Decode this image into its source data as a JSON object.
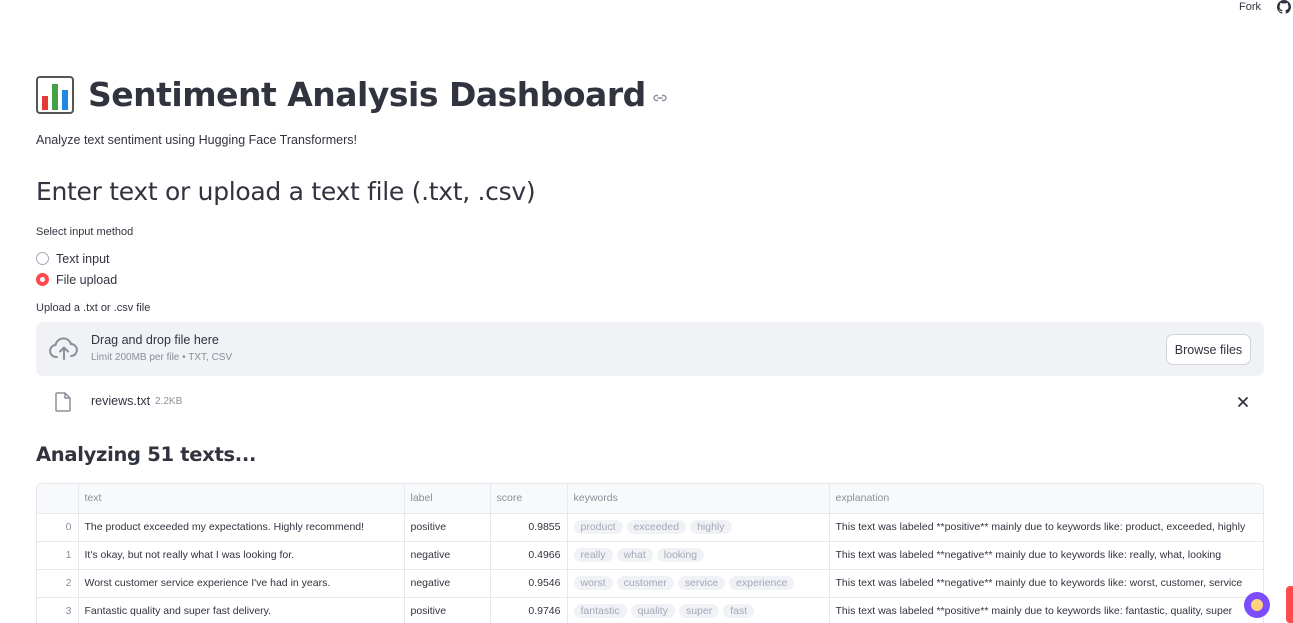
{
  "topbar": {
    "fork_label": "Fork",
    "icon": "github-icon"
  },
  "header": {
    "emoji_icon": "bar-chart-icon",
    "title": "Sentiment Analysis Dashboard",
    "anchor_icon": "link-icon",
    "subtitle": "Analyze text sentiment using Hugging Face Transformers!"
  },
  "input_section": {
    "heading": "Enter text or upload a text file (.txt, .csv)",
    "radio_label": "Select input method",
    "options": [
      {
        "label": "Text input",
        "checked": false
      },
      {
        "label": "File upload",
        "checked": true
      }
    ],
    "accent": "#ff4b4b"
  },
  "uploader": {
    "label": "Upload a .txt or .csv file",
    "drop_text": "Drag and drop file here",
    "limit_text": "Limit 200MB per file • TXT, CSV",
    "browse_label": "Browse files",
    "file_name": "reviews.txt",
    "file_size": "2.2KB"
  },
  "results": {
    "heading": "Analyzing 51 texts...",
    "columns": [
      "",
      "text",
      "label",
      "score",
      "keywords",
      "explanation"
    ],
    "rows": [
      {
        "index": "0",
        "text": "The product exceeded my expectations. Highly recommend!",
        "label": "positive",
        "score": "0.9855",
        "keywords": [
          "product",
          "exceeded",
          "highly"
        ],
        "explanation": "This text was labeled **positive** mainly due to keywords like: product, exceeded, highly"
      },
      {
        "index": "1",
        "text": "It's okay, but not really what I was looking for.",
        "label": "negative",
        "score": "0.4966",
        "keywords": [
          "really",
          "what",
          "looking"
        ],
        "explanation": "This text was labeled **negative** mainly due to keywords like: really, what, looking"
      },
      {
        "index": "2",
        "text": "Worst customer service experience I've had in years.",
        "label": "negative",
        "score": "0.9546",
        "keywords": [
          "worst",
          "customer",
          "service",
          "experience"
        ],
        "explanation": "This text was labeled **negative** mainly due to keywords like: worst, customer, service"
      },
      {
        "index": "3",
        "text": "Fantastic quality and super fast delivery.",
        "label": "positive",
        "score": "0.9746",
        "keywords": [
          "fantastic",
          "quality",
          "super",
          "fast"
        ],
        "explanation": "This text was labeled **positive** mainly due to keywords like: fantastic, quality, super"
      }
    ]
  }
}
